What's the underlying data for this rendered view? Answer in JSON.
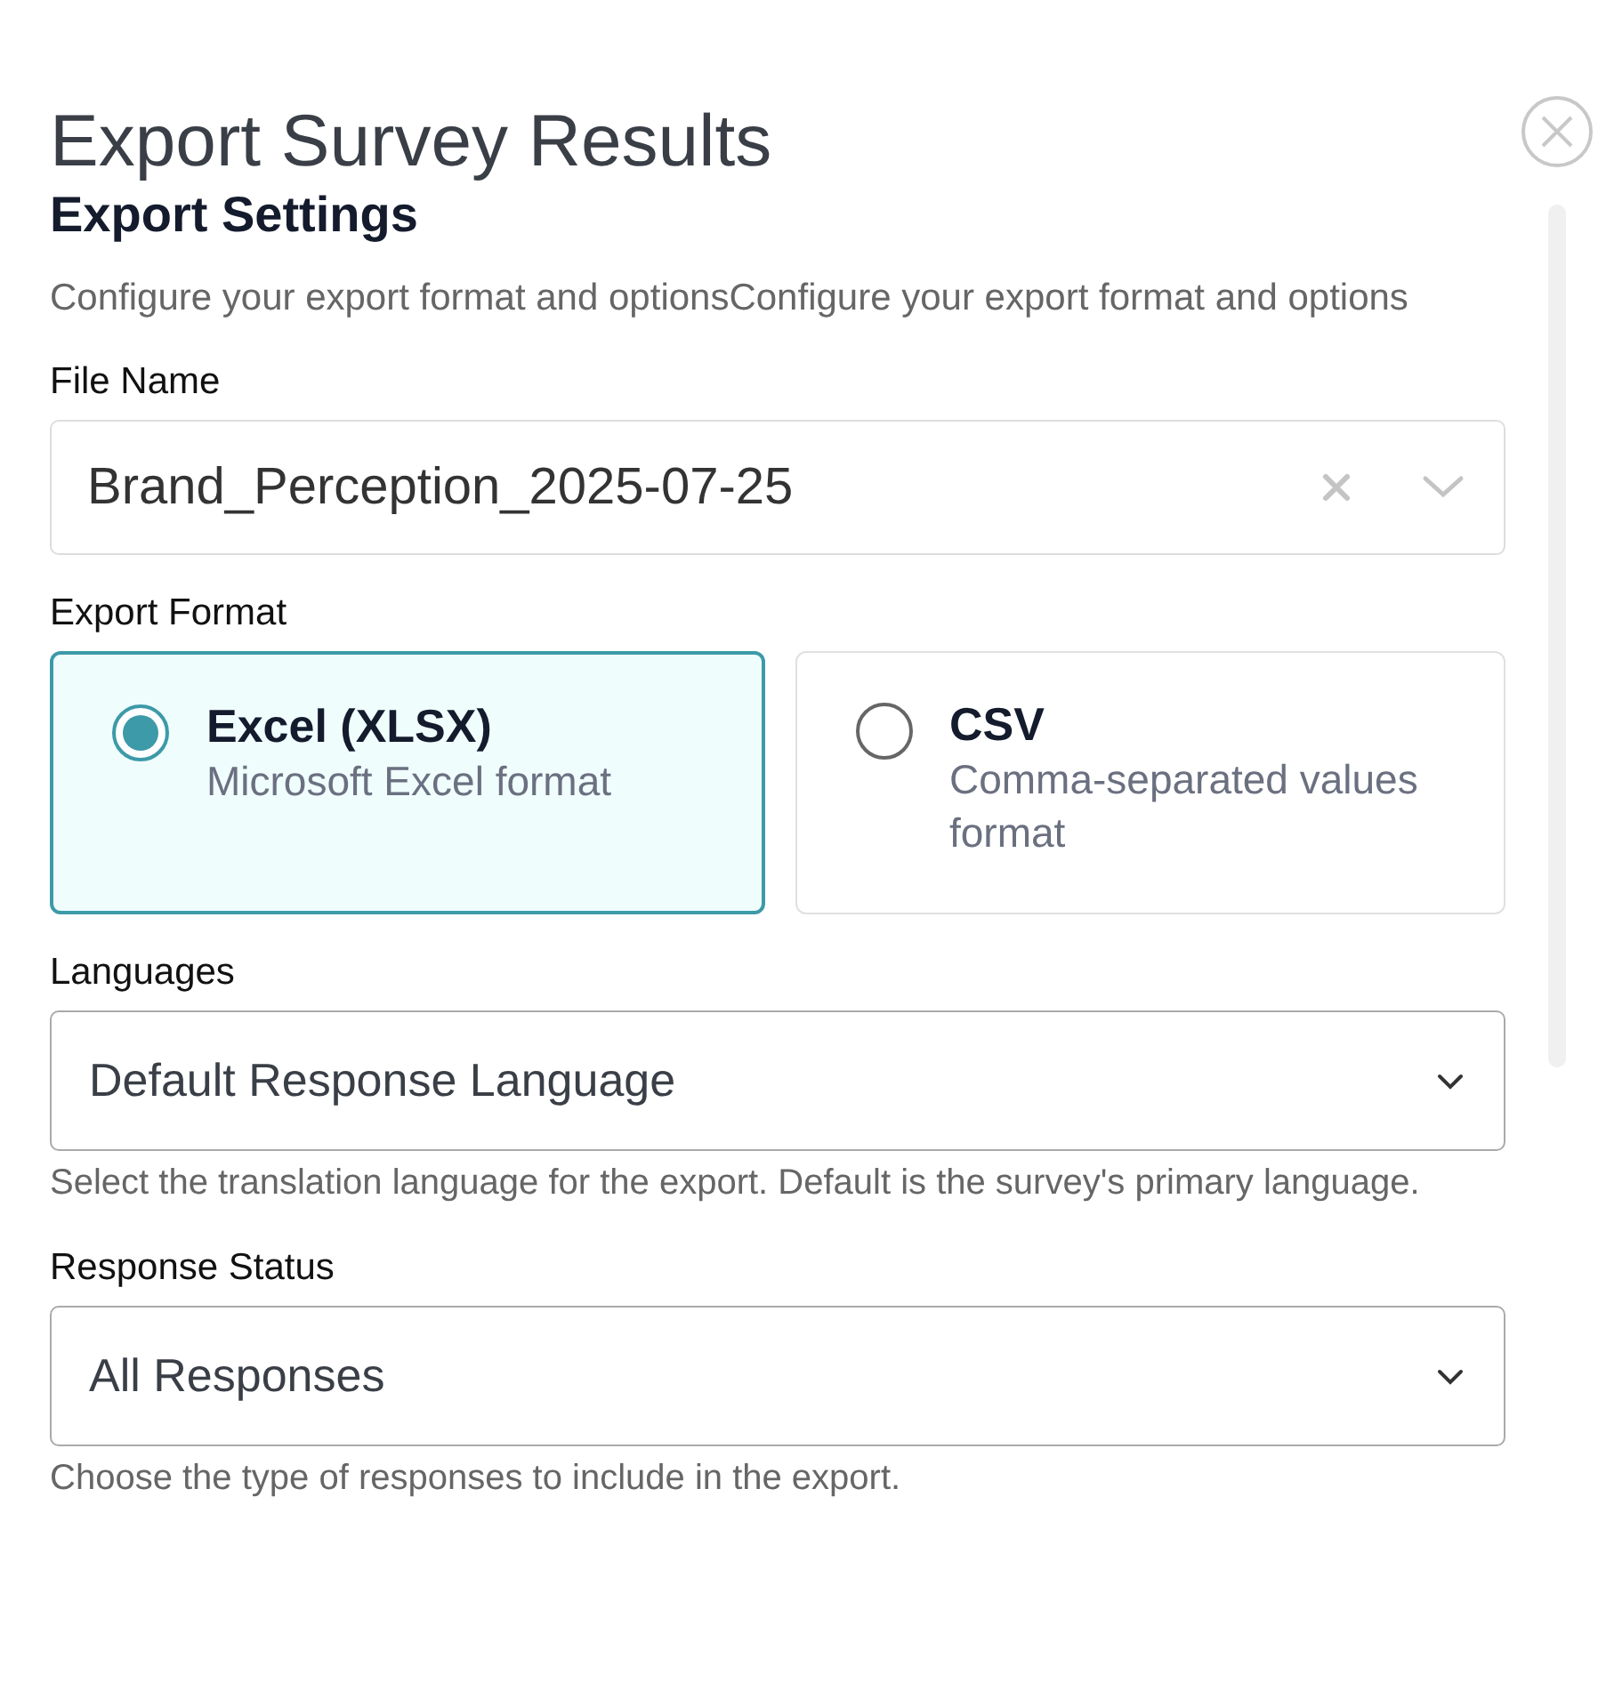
{
  "dialog": {
    "title": "Export Survey Results"
  },
  "section": {
    "title": "Export Settings",
    "description": "Configure your export format and optionsConfigure your export format and options"
  },
  "file_name": {
    "label": "File Name",
    "value": "Brand_Perception_2025-07-25"
  },
  "export_format": {
    "label": "Export Format",
    "options": [
      {
        "title": "Excel (XLSX)",
        "description": "Microsoft Excel format",
        "selected": true
      },
      {
        "title": "CSV",
        "description": "Comma-separated values format",
        "selected": false
      }
    ]
  },
  "languages": {
    "label": "Languages",
    "value": "Default Response Language",
    "help": "Select the translation language for the export. Default is the survey's primary language."
  },
  "response_status": {
    "label": "Response Status",
    "value": "All Responses",
    "help": "Choose the type of responses to include in the export."
  }
}
